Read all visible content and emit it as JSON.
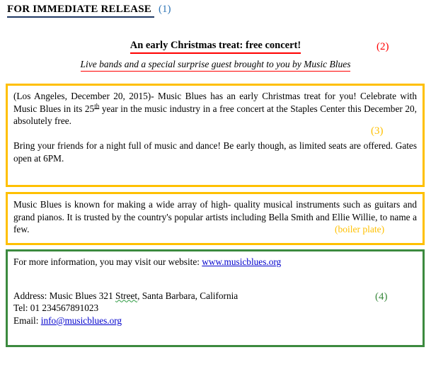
{
  "document": {
    "release_header": "FOR IMMEDIATE RELEASE",
    "annotation_1": "(1)",
    "headline": "An early Christmas treat: free concert!",
    "annotation_2": "(2)",
    "subheadline": "Live bands and a special surprise guest brought to you by Music Blues",
    "body_box": {
      "annotation": "(3)",
      "paragraph_1_part_1": "(Los Angeles, December 20, 2015)- Music Blues has an early Christmas treat for you! Celebrate with Music Blues in its 25",
      "paragraph_1_ordinal": "th",
      "paragraph_1_part_2": " year in the music industry in a free concert at the Staples Center this December 20, absolutely free.",
      "paragraph_2": "Bring your friends for a night full of music and dance! Be early though, as limited seats are offered. Gates open at 6PM."
    },
    "boiler_box": {
      "annotation": "(boiler plate)",
      "paragraph": "Music Blues is known for making a wide array of high- quality musical instruments such as guitars and grand pianos. It is trusted by the country's popular artists including Bella Smith and Ellie Willie, to name a few."
    },
    "contact_box": {
      "annotation": "(4)",
      "website_intro": "For more information, you may visit our website: ",
      "website_url": "www.musicblues.org",
      "address_label": "Address:  Music Blues 321 ",
      "address_street_word": "Street",
      "address_rest": ", Santa Barbara, California",
      "tel": "Tel: 01 234567891023",
      "email_label": "Email: ",
      "email_address": "info@musicblues.org"
    }
  },
  "colors": {
    "header_underline": "#1F3864",
    "annotation_1": "#2E74B5",
    "headline_underline": "#FF0000",
    "annotation_2": "#FF0000",
    "yellow_border": "#FFC000",
    "green_border": "#3C8A3F",
    "link": "#0000CC",
    "grammar_squiggle": "#2E9B42"
  }
}
